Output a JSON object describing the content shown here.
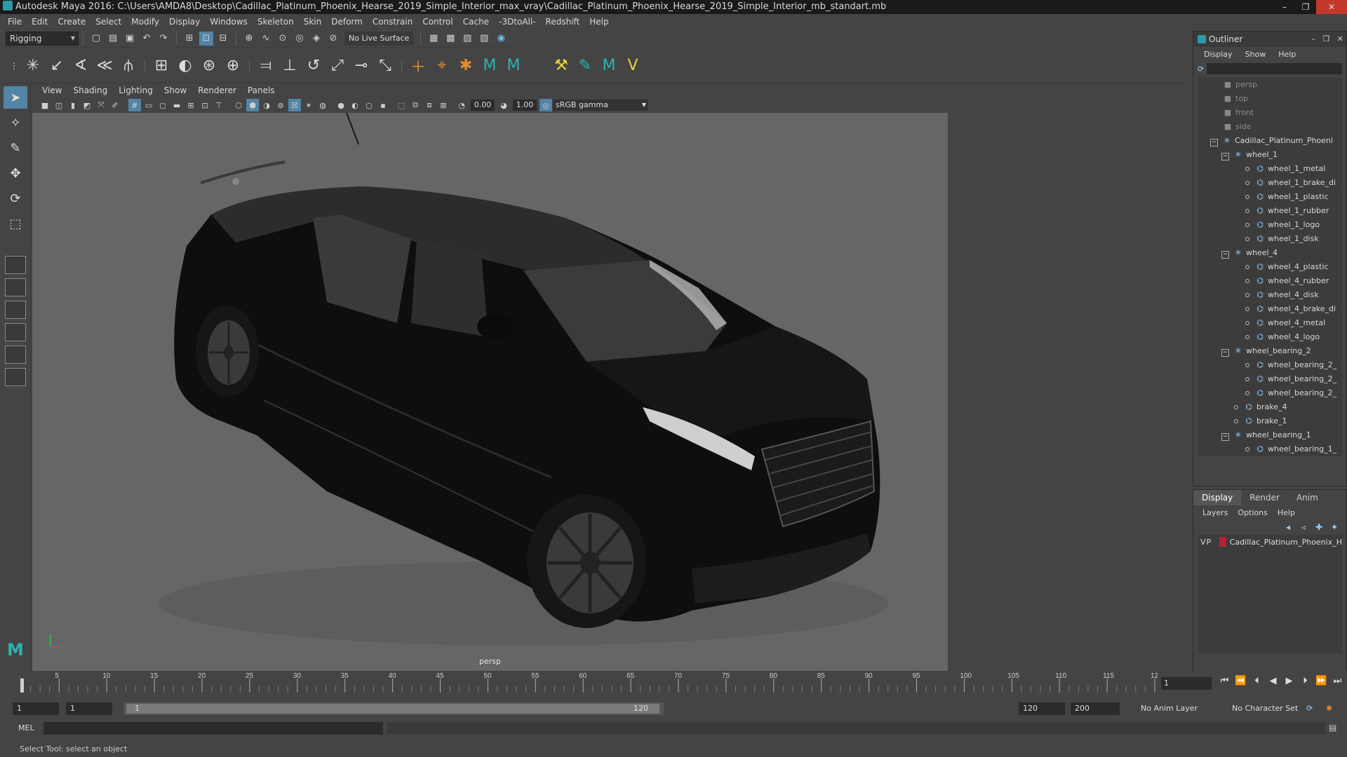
{
  "window": {
    "title": "Autodesk Maya 2016: C:\\Users\\AMDA8\\Desktop\\Cadillac_Platinum_Phoenix_Hearse_2019_Simple_Interior_max_vray\\Cadillac_Platinum_Phoenix_Hearse_2019_Simple_Interior_mb_standart.mb"
  },
  "menubar": [
    "File",
    "Edit",
    "Create",
    "Select",
    "Modify",
    "Display",
    "Windows",
    "Skeleton",
    "Skin",
    "Deform",
    "Constrain",
    "Control",
    "Cache",
    "-3DtoAll-",
    "Redshift",
    "Help"
  ],
  "statusline": {
    "mode": "Rigging",
    "live_surface": "No Live Surface"
  },
  "viewport": {
    "menu": [
      "View",
      "Shading",
      "Lighting",
      "Show",
      "Renderer",
      "Panels"
    ],
    "exposure": "0.00",
    "gamma_value": "1.00",
    "color_space": "sRGB gamma",
    "camera_label": "persp"
  },
  "outliner": {
    "title": "Outliner",
    "menu": [
      "Display",
      "Show",
      "Help"
    ],
    "items": [
      {
        "label": "persp",
        "depth": 0,
        "kind": "camera",
        "dim": true
      },
      {
        "label": "top",
        "depth": 0,
        "kind": "camera",
        "dim": true
      },
      {
        "label": "front",
        "depth": 0,
        "kind": "camera",
        "dim": true
      },
      {
        "label": "side",
        "depth": 0,
        "kind": "camera",
        "dim": true
      },
      {
        "label": "Cadillac_Platinum_Phoeni",
        "depth": 0,
        "kind": "group",
        "expanded": true
      },
      {
        "label": "wheel_1",
        "depth": 1,
        "kind": "group",
        "expanded": true
      },
      {
        "label": "wheel_1_metal",
        "depth": 2,
        "kind": "mesh"
      },
      {
        "label": "wheel_1_brake_di",
        "depth": 2,
        "kind": "mesh"
      },
      {
        "label": "wheel_1_plastic",
        "depth": 2,
        "kind": "mesh"
      },
      {
        "label": "wheel_1_rubber",
        "depth": 2,
        "kind": "mesh"
      },
      {
        "label": "wheel_1_logo",
        "depth": 2,
        "kind": "mesh"
      },
      {
        "label": "wheel_1_disk",
        "depth": 2,
        "kind": "mesh"
      },
      {
        "label": "wheel_4",
        "depth": 1,
        "kind": "group",
        "expanded": true
      },
      {
        "label": "wheel_4_plastic",
        "depth": 2,
        "kind": "mesh"
      },
      {
        "label": "wheel_4_rubber",
        "depth": 2,
        "kind": "mesh"
      },
      {
        "label": "wheel_4_disk",
        "depth": 2,
        "kind": "mesh"
      },
      {
        "label": "wheel_4_brake_di",
        "depth": 2,
        "kind": "mesh"
      },
      {
        "label": "wheel_4_metal",
        "depth": 2,
        "kind": "mesh"
      },
      {
        "label": "wheel_4_logo",
        "depth": 2,
        "kind": "mesh"
      },
      {
        "label": "wheel_bearing_2",
        "depth": 1,
        "kind": "group",
        "expanded": true
      },
      {
        "label": "wheel_bearing_2_",
        "depth": 2,
        "kind": "mesh"
      },
      {
        "label": "wheel_bearing_2_",
        "depth": 2,
        "kind": "mesh"
      },
      {
        "label": "wheel_bearing_2_",
        "depth": 2,
        "kind": "mesh"
      },
      {
        "label": "brake_4",
        "depth": 1,
        "kind": "mesh"
      },
      {
        "label": "brake_1",
        "depth": 1,
        "kind": "mesh"
      },
      {
        "label": "wheel_bearing_1",
        "depth": 1,
        "kind": "group",
        "expanded": true
      },
      {
        "label": "wheel_bearing_1_",
        "depth": 2,
        "kind": "mesh"
      }
    ]
  },
  "layers": {
    "tabs": [
      "Display",
      "Render",
      "Anim"
    ],
    "active_tab": "Display",
    "menu": [
      "Layers",
      "Options",
      "Help"
    ],
    "rows": [
      {
        "v": "V",
        "p": "P",
        "name": "Cadillac_Platinum_Phoenix_H",
        "color": "#b3203a"
      }
    ]
  },
  "timeline": {
    "start": 1,
    "end": 120,
    "major_step": 5,
    "current_frame": "1"
  },
  "range": {
    "start": "1",
    "anim_start": "1",
    "slider_start": "1",
    "slider_end": "120",
    "playback_end": "120",
    "anim_end": "200",
    "anim_layer": "No Anim Layer",
    "character_set": "No Character Set"
  },
  "cmdline": {
    "lang": "MEL"
  },
  "helpline": {
    "text": "Select Tool: select an object"
  },
  "colors": {
    "accent": "#5285a6",
    "maya_teal": "#2ab5b0",
    "layer_red": "#b3203a"
  }
}
